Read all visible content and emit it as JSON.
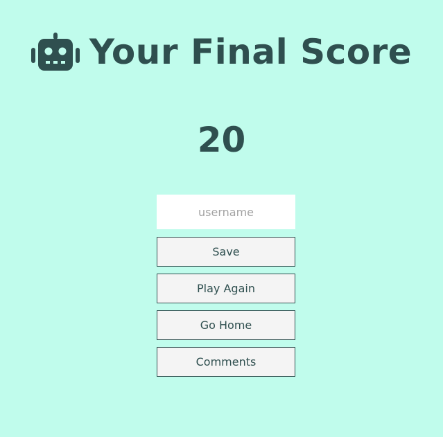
{
  "header": {
    "icon": "robot-icon",
    "title": "Your Final Score"
  },
  "score": {
    "value": "20"
  },
  "form": {
    "username_placeholder": "username",
    "username_value": "",
    "save_label": "Save",
    "play_again_label": "Play Again",
    "go_home_label": "Go Home",
    "comments_label": "Comments"
  },
  "colors": {
    "background": "#c0fcec",
    "text": "#2f4f4f",
    "button_bg": "#f4f4f4",
    "input_bg": "#ffffff",
    "placeholder": "#a3a3a3"
  }
}
